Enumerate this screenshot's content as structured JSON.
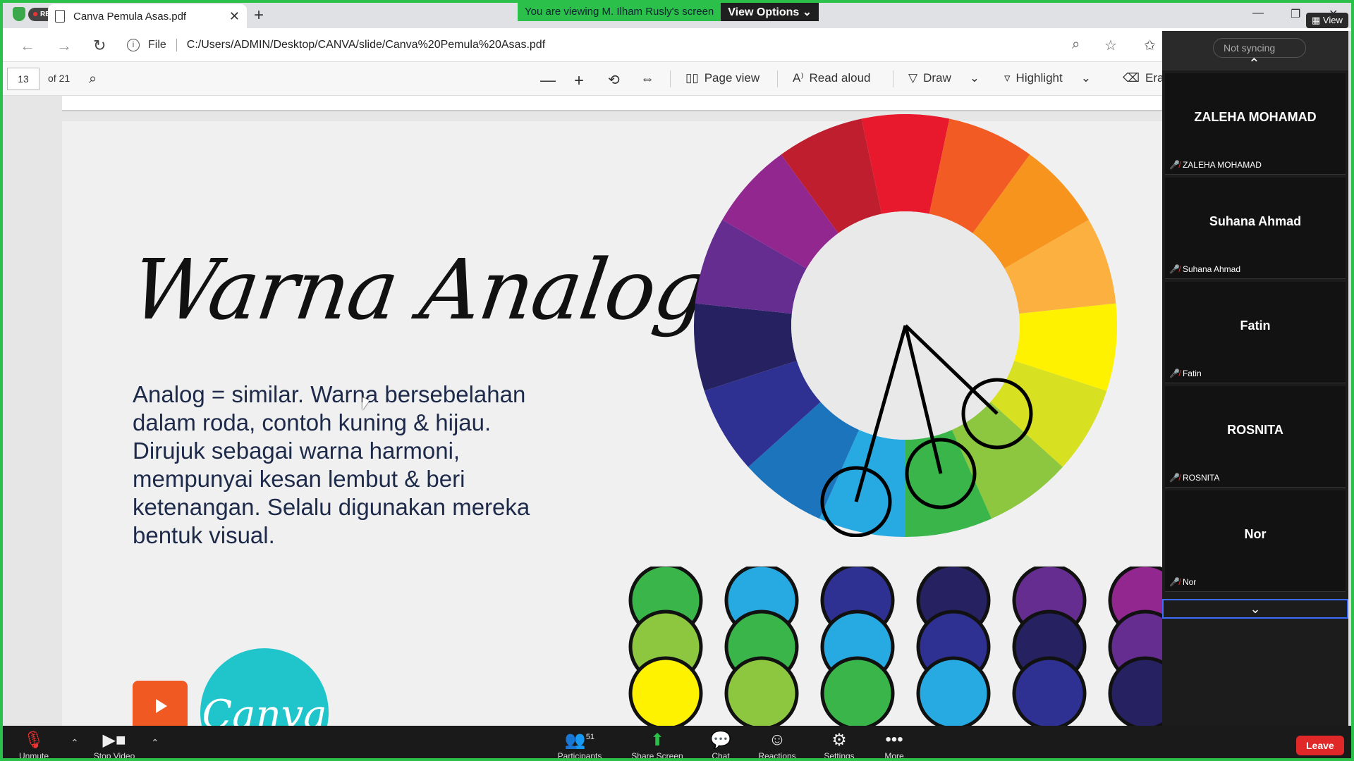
{
  "browser": {
    "tab_title": "Canva Pemula Asas.pdf",
    "rec_label": "REC",
    "banner_text": "You are viewing M. Ilham Rusly's screen",
    "view_options": "View Options",
    "view_label": "View",
    "file_label": "File",
    "url": "C:/Users/ADMIN/Desktop/CANVA/slide/Canva%20Pemula%20Asas.pdf"
  },
  "pdf_toolbar": {
    "page_number": "13",
    "page_total": "of 21",
    "page_view": "Page view",
    "read_aloud": "Read aloud",
    "draw": "Draw",
    "highlight": "Highlight",
    "erase": "Era"
  },
  "slide": {
    "title": "Warna Analog",
    "body": "Analog = similar. Warna bersebelahan dalam roda, contoh kuning & hijau. Dirujuk sebagai warna harmoni, mempunyai kesan lembut  & beri ketenangan. Selalu digunakan mereka bentuk visual.",
    "logo_text": "Canva",
    "wheel_colors": [
      "#e8192c",
      "#f35b24",
      "#f7941d",
      "#fbb040",
      "#fff200",
      "#d7e021",
      "#8dc63f",
      "#39b54a",
      "#27aae1",
      "#1c75bc",
      "#2e3192",
      "#262262",
      "#662d91",
      "#92278f",
      "#be1e2d"
    ],
    "swatch_columns": [
      [
        "#39b54a",
        "#8dc63f",
        "#fff200"
      ],
      [
        "#27aae1",
        "#39b54a",
        "#8dc63f"
      ],
      [
        "#2e3192",
        "#27aae1",
        "#39b54a"
      ],
      [
        "#262262",
        "#2e3192",
        "#27aae1"
      ],
      [
        "#662d91",
        "#262262",
        "#2e3192"
      ],
      [
        "#92278f",
        "#662d91",
        "#262262"
      ]
    ]
  },
  "panel": {
    "not_syncing": "Not syncing",
    "participants": [
      {
        "name": "ZALEHA MOHAMAD",
        "label": "ZALEHA MOHAMAD"
      },
      {
        "name": "Suhana Ahmad",
        "label": "Suhana Ahmad"
      },
      {
        "name": "Fatin",
        "label": "Fatin"
      },
      {
        "name": "ROSNITA",
        "label": "ROSNITA"
      },
      {
        "name": "Nor",
        "label": "Nor"
      }
    ]
  },
  "zoom_toolbar": {
    "unmute": "Unmute",
    "stop_video": "Stop Video",
    "participants": "Participants",
    "participant_count": "51",
    "share_screen": "Share Screen",
    "chat": "Chat",
    "reactions": "Reactions",
    "settings": "Settings",
    "more": "More",
    "leave": "Leave"
  }
}
